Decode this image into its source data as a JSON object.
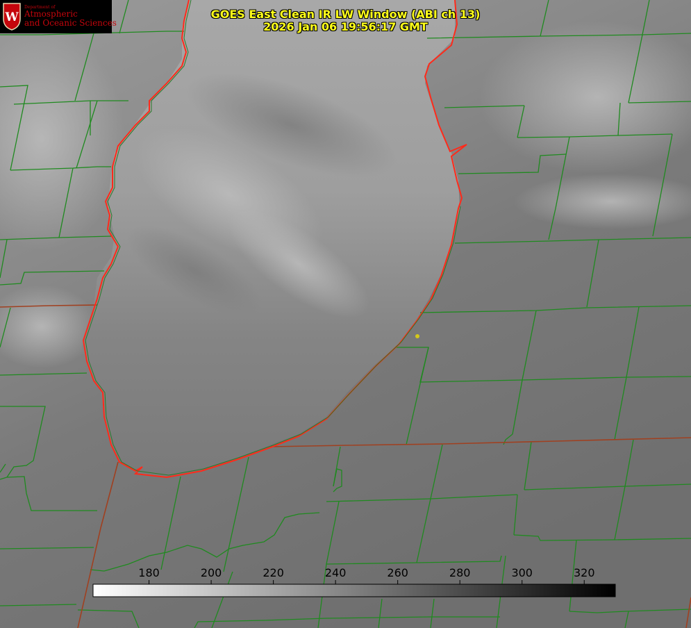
{
  "header": {
    "title_line1": "GOES East Clean IR LW Window (ABI ch 13)",
    "title_line2": "2026 Jan 06 19:56:17 GMT",
    "title_color": "#ffff1a"
  },
  "logo": {
    "department": "Department of",
    "line1": "Atmospheric",
    "line2": "and Oceanic Sciences",
    "seal_letter": "W",
    "brand_color": "#c5050c"
  },
  "colorbar": {
    "ticks": [
      "180",
      "200",
      "220",
      "240",
      "260",
      "280",
      "300",
      "320"
    ],
    "min_value": 162,
    "max_value": 330,
    "gradient_start": "#ffffff",
    "gradient_end": "#000000"
  },
  "map": {
    "coastline_color": "#ff2a1a",
    "county_line_color": "#1f8a1f",
    "state_line_color": "#a04020",
    "marker_color": "#d4c81a"
  }
}
